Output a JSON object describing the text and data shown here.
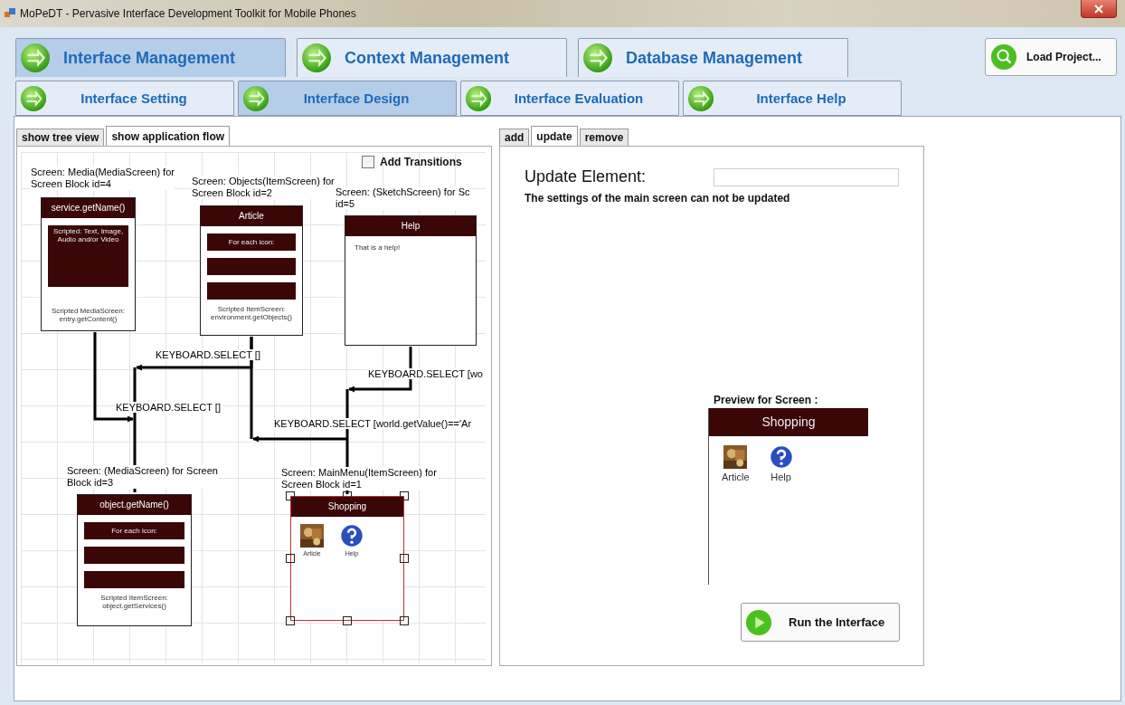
{
  "window": {
    "title": "MoPeDT - Pervasive Interface Development Toolkit for Mobile Phones"
  },
  "main_tabs": [
    {
      "label": "Interface Management",
      "selected": true
    },
    {
      "label": "Context Management",
      "selected": false
    },
    {
      "label": "Database Management",
      "selected": false
    }
  ],
  "load_button": {
    "label": "Load Project..."
  },
  "sub_tabs": [
    {
      "label": "Interface Setting",
      "selected": false
    },
    {
      "label": "Interface Design",
      "selected": true
    },
    {
      "label": "Interface Evaluation",
      "selected": false
    },
    {
      "label": "Interface Help",
      "selected": false
    }
  ],
  "flow_tabs": [
    {
      "label": "show tree view",
      "selected": false
    },
    {
      "label": "show application flow",
      "selected": true
    }
  ],
  "add_transitions": {
    "label": "Add Transitions",
    "checked": false
  },
  "screens": [
    {
      "kind": "media",
      "caption": [
        "Screen: Media(MediaScreen) for",
        "Screen Block id=4"
      ],
      "header": "service.getName()",
      "content": "Scripted: Text, Image, Audio and/or Video",
      "footer": "Scripted MediaScreen: entry.getContent()",
      "selected": false
    },
    {
      "kind": "item",
      "caption": [
        "Screen: Objects(ItemScreen) for",
        "Screen Block id=2"
      ],
      "header": "Article",
      "content": "For each icon:",
      "footer": "Scripted ItemScreen: environment.getObjects()",
      "selected": false
    },
    {
      "kind": "sketch",
      "caption": [
        "Screen: (SketchScreen) for Sc",
        "id=5"
      ],
      "header": "Help",
      "content": "That is a help!",
      "selected": false
    },
    {
      "kind": "item",
      "caption": [
        "Screen: (MediaScreen) for Screen",
        "Block id=3"
      ],
      "header": "object.getName()",
      "content": "For each icon:",
      "footer": "Scripted ItemScreen: object.getServices()",
      "selected": false
    },
    {
      "kind": "menu",
      "caption": [
        "Screen: MainMenu(ItemScreen) for",
        "Screen Block id=1"
      ],
      "header": "Shopping",
      "icons": [
        {
          "label": "Article",
          "kind": "picture"
        },
        {
          "label": "Help",
          "kind": "help"
        }
      ],
      "selected": true
    }
  ],
  "transitions": [
    {
      "label": "KEYBOARD.SELECT []"
    },
    {
      "label": "KEYBOARD.SELECT []"
    },
    {
      "label": "KEYBOARD.SELECT [wo"
    },
    {
      "label": "KEYBOARD.SELECT [world.getValue()=='Ar"
    }
  ],
  "edit_tabs": [
    {
      "label": "add",
      "selected": false
    },
    {
      "label": "update",
      "selected": true
    },
    {
      "label": "remove",
      "selected": false
    }
  ],
  "update": {
    "label": "Update Element:",
    "message": "The settings of the main screen can not be updated"
  },
  "preview": {
    "label": "Preview for Screen :",
    "header": "Shopping",
    "icons": [
      {
        "label": "Article",
        "kind": "picture"
      },
      {
        "label": "Help",
        "kind": "help"
      }
    ]
  },
  "run_button": {
    "label": "Run the Interface"
  }
}
